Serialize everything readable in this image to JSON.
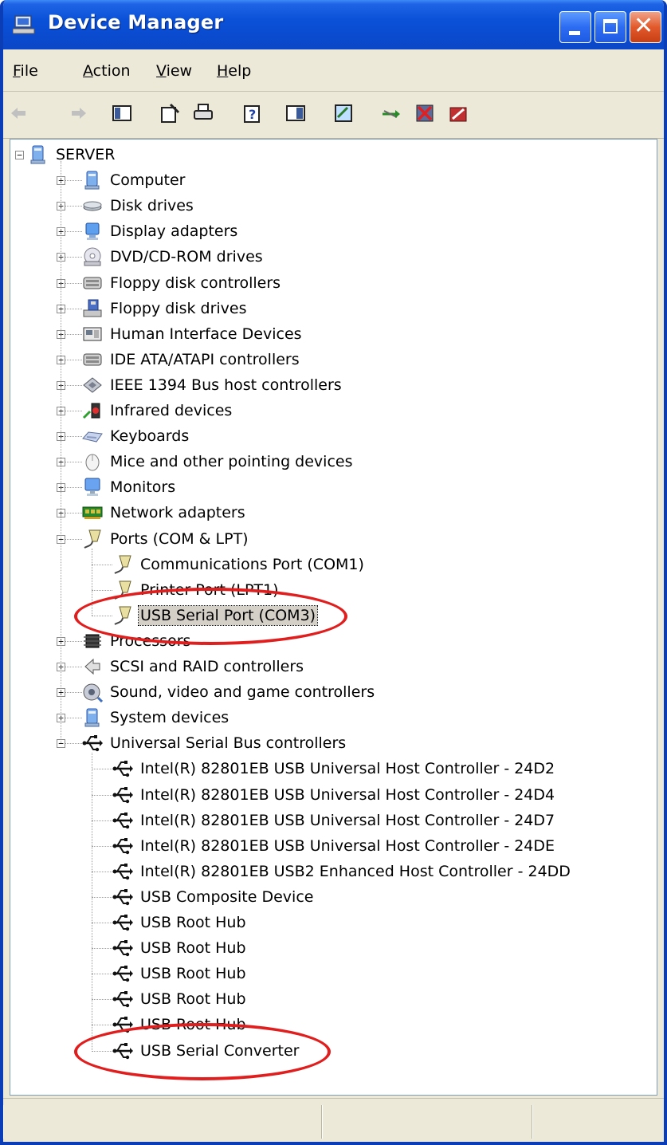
{
  "window": {
    "title": "Device Manager"
  },
  "menu": [
    {
      "label": "File",
      "accel": "F",
      "rest": "ile"
    },
    {
      "label": "Action",
      "accel": "A",
      "rest": "ction"
    },
    {
      "label": "View",
      "accel": "V",
      "rest": "iew"
    },
    {
      "label": "Help",
      "accel": "H",
      "rest": "elp"
    }
  ],
  "toolbar": [
    {
      "icon": "back-arrow-icon",
      "enabled": false
    },
    {
      "icon": "forward-arrow-icon",
      "enabled": false
    },
    {
      "icon": "show-hide-console-tree-icon",
      "enabled": true
    },
    {
      "icon": "properties-icon",
      "enabled": true
    },
    {
      "icon": "print-icon",
      "enabled": true
    },
    {
      "icon": "help-icon",
      "enabled": true
    },
    {
      "icon": "show-hide-action-pane-icon",
      "enabled": true
    },
    {
      "icon": "scan-hardware-changes-icon",
      "enabled": true
    },
    {
      "icon": "update-driver-icon",
      "enabled": true
    },
    {
      "icon": "disable-device-icon",
      "enabled": true
    },
    {
      "icon": "uninstall-device-icon",
      "enabled": true
    }
  ],
  "tree": {
    "root": {
      "label": "SERVER",
      "icon": "computer-icon",
      "expanded": true
    },
    "categories": [
      {
        "label": "Computer",
        "icon": "computer-icon",
        "expanded": false
      },
      {
        "label": "Disk drives",
        "icon": "disk-drive-icon",
        "expanded": false
      },
      {
        "label": "Display adapters",
        "icon": "display-adapter-icon",
        "expanded": false
      },
      {
        "label": "DVD/CD-ROM drives",
        "icon": "cdrom-icon",
        "expanded": false
      },
      {
        "label": "Floppy disk controllers",
        "icon": "controller-icon",
        "expanded": false
      },
      {
        "label": "Floppy disk drives",
        "icon": "floppy-drive-icon",
        "expanded": false
      },
      {
        "label": "Human Interface Devices",
        "icon": "hid-icon",
        "expanded": false
      },
      {
        "label": "IDE ATA/ATAPI controllers",
        "icon": "controller-icon",
        "expanded": false
      },
      {
        "label": "IEEE 1394 Bus host controllers",
        "icon": "ieee1394-icon",
        "expanded": false
      },
      {
        "label": "Infrared devices",
        "icon": "infrared-icon",
        "expanded": false
      },
      {
        "label": "Keyboards",
        "icon": "keyboard-icon",
        "expanded": false
      },
      {
        "label": "Mice and other pointing devices",
        "icon": "mouse-icon",
        "expanded": false
      },
      {
        "label": "Monitors",
        "icon": "monitor-icon",
        "expanded": false
      },
      {
        "label": "Network adapters",
        "icon": "network-adapter-icon",
        "expanded": false
      },
      {
        "label": "Ports (COM & LPT)",
        "icon": "port-icon",
        "expanded": true,
        "children": [
          {
            "label": "Communications Port (COM1)",
            "icon": "port-icon",
            "selected": false
          },
          {
            "label": "Printer Port (LPT1)",
            "icon": "port-icon",
            "selected": false
          },
          {
            "label": "USB Serial Port (COM3)",
            "icon": "port-icon",
            "selected": true
          }
        ]
      },
      {
        "label": "Processors",
        "icon": "processor-icon",
        "expanded": false
      },
      {
        "label": "SCSI and RAID controllers",
        "icon": "scsi-icon",
        "expanded": false
      },
      {
        "label": "Sound, video and game controllers",
        "icon": "sound-icon",
        "expanded": false
      },
      {
        "label": "System devices",
        "icon": "computer-icon",
        "expanded": false
      },
      {
        "label": "Universal Serial Bus controllers",
        "icon": "usb-icon",
        "expanded": true,
        "children": [
          {
            "label": "Intel(R) 82801EB USB Universal Host Controller - 24D2",
            "icon": "usb-icon"
          },
          {
            "label": "Intel(R) 82801EB USB Universal Host Controller - 24D4",
            "icon": "usb-icon"
          },
          {
            "label": "Intel(R) 82801EB USB Universal Host Controller - 24D7",
            "icon": "usb-icon"
          },
          {
            "label": "Intel(R) 82801EB USB Universal Host Controller - 24DE",
            "icon": "usb-icon"
          },
          {
            "label": "Intel(R) 82801EB USB2 Enhanced Host Controller - 24DD",
            "icon": "usb-icon"
          },
          {
            "label": "USB Composite Device",
            "icon": "usb-icon"
          },
          {
            "label": "USB Root Hub",
            "icon": "usb-icon"
          },
          {
            "label": "USB Root Hub",
            "icon": "usb-icon"
          },
          {
            "label": "USB Root Hub",
            "icon": "usb-icon"
          },
          {
            "label": "USB Root Hub",
            "icon": "usb-icon"
          },
          {
            "label": "USB Root Hub",
            "icon": "usb-icon"
          },
          {
            "label": "USB Serial Converter",
            "icon": "usb-icon"
          }
        ]
      }
    ]
  },
  "annotations": [
    {
      "target": "USB Serial Port (COM3)",
      "color": "#e01e1e",
      "shape": "ellipse"
    },
    {
      "target": "USB Serial Converter",
      "color": "#e01e1e",
      "shape": "ellipse"
    }
  ],
  "statusbar": {
    "panes": [
      "",
      "",
      ""
    ]
  }
}
